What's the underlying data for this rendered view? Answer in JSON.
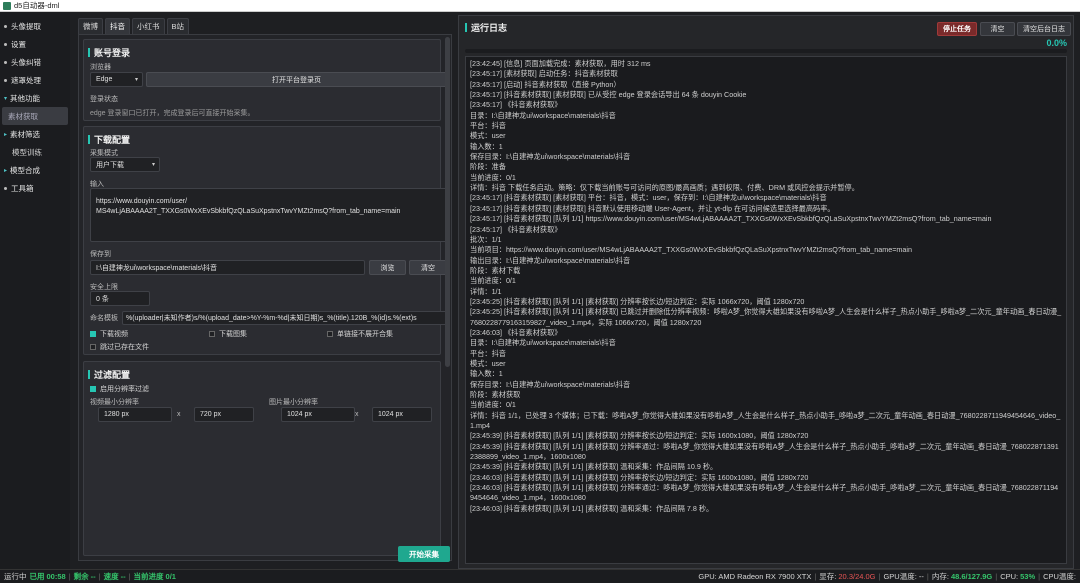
{
  "window": {
    "title": "d5自动器-dml"
  },
  "sidebar": {
    "items": [
      {
        "label": "头像提取",
        "type": "top"
      },
      {
        "label": "设置",
        "type": "top"
      },
      {
        "label": "头像纠错",
        "type": "top"
      },
      {
        "label": "遮罩处理",
        "type": "top"
      },
      {
        "label": "其他功能",
        "type": "group"
      },
      {
        "label": "素材获取",
        "type": "active"
      },
      {
        "label": "素材筛选",
        "type": "group"
      },
      {
        "label": "模型训练",
        "type": "sub"
      },
      {
        "label": "模型合成",
        "type": "group"
      },
      {
        "label": "工具箱",
        "type": "top"
      }
    ]
  },
  "tabs": [
    "微博",
    "抖音",
    "小红书",
    "B站"
  ],
  "account": {
    "title": "账号登录",
    "browser_label": "浏览器",
    "browser_value": "Edge",
    "open_login_button": "打开平台登录页",
    "login_status_label": "登录状态",
    "login_status_text": "edge 登录窗口已打开，完成登录后可直接开始采集。"
  },
  "download": {
    "title": "下载配置",
    "mode_label": "采集模式",
    "mode_value": "用户下载",
    "input_label": "输入",
    "input_value": "https://www.douyin.com/user/\nMS4wLjABAAAA2T_TXXGs0WxXEvSbkbfQzQLaSuXpstnxTwvYMZt2msQ?from_tab_name=main",
    "save_label": "保存到",
    "save_value": "I:\\自建神龙ui\\workspace\\materials\\抖音",
    "browse_button": "浏览",
    "clear_button": "清空",
    "limit_label": "安全上限",
    "limit_value": "0 条",
    "naming_label": "命名模板",
    "naming_value": "%(uploader|未知作者)s/%(upload_date>%Y-%m-%d|未知日期)s_%(title).120B_%(id)s.%(ext)s",
    "opt_video": "下载视频",
    "opt_images": "下载图集",
    "opt_single": "单链接不展开合集",
    "opt_skip": "跳过已存在文件"
  },
  "filter": {
    "title": "过滤配置",
    "enable_label": "启用分辨率过滤",
    "video_min_label": "视频最小分辨率",
    "video_w": "1280 px",
    "video_h": "720 px",
    "image_min_label": "图片最小分辨率",
    "image_w": "1024 px",
    "image_h": "1024 px",
    "x": "x"
  },
  "start_button": "开始采集",
  "log_panel": {
    "title": "运行日志",
    "stop_button": "停止任务",
    "clear_button": "清空",
    "clear_bg_button": "清空后台日志",
    "progress_text": "0.0%",
    "progress_fraction": 0.0,
    "lines": [
      "[23:42:45] [信息] 页面加载完成：素材获取，用时 312 ms",
      "[23:45:17] [素材获取] 启动任务：抖音素材获取",
      "[23:45:17] [启动] 抖音素材获取（直接 Python）",
      "[23:45:17] [抖音素材获取] [素材获取] 已从受控 edge 登录会话导出 64 条 douyin Cookie",
      "[23:45:17] 《抖音素材获取》",
      "目录：I:\\自建神龙ui\\workspace\\materials\\抖音",
      "平台：抖音",
      "模式：user",
      "输入数：1",
      "保存目录：I:\\自建神龙ui\\workspace\\materials\\抖音",
      "阶段：准备",
      "当前进度：0/1",
      "详情：抖音 下载任务启动。策略：仅下载当前账号可访问的原图/最高画质；遇到权限、付费、DRM 或风控会提示并暂停。",
      "[23:45:17] [抖音素材获取] [素材获取] 平台：抖音，模式：user，保存到：I:\\自建神龙ui\\workspace\\materials\\抖音",
      "[23:45:17] [抖音素材获取] [素材获取] 抖音默认使用移动端 User-Agent，并让 yt-dlp 在可访问候选里选择最高码率。",
      "[23:45:17] [抖音素材获取] [队列 1/1] https://www.douyin.com/user/MS4wLjABAAAA2T_TXXGs0WxXEvSbkbfQzQLaSuXpstnxTwvYMZt2msQ?from_tab_name=main",
      "[23:45:17] 《抖音素材获取》",
      "批次：1/1",
      "当前项目：https://www.douyin.com/user/MS4wLjABAAAA2T_TXXGs0WxXEvSbkbfQzQLaSuXpstnxTwvYMZt2msQ?from_tab_name=main",
      "输出目录：I:\\自建神龙ui\\workspace\\materials\\抖音",
      "阶段：素材下载",
      "当前进度：0/1",
      "详情：1/1",
      "[23:45:25] [抖音素材获取] [队列 1/1] [素材获取] 分辨率按长边/短边判定：实际 1066x720，阈值 1280x720",
      "[23:45:25] [抖音素材获取] [队列 1/1] [素材获取] 已跳过并删除低分辨率视频：哆啦A梦_你觉得大雄如果没有哆啦A梦_人生会是什么样子_热点小助手_哆啦a梦_二次元_童年动画_春日动漫_7680228779163159827_video_1.mp4，实际 1066x720，阈值 1280x720",
      "[23:46:03] 《抖音素材获取》",
      "目录：I:\\自建神龙ui\\workspace\\materials\\抖音",
      "平台：抖音",
      "模式：user",
      "输入数：1",
      "保存目录：I:\\自建神龙ui\\workspace\\materials\\抖音",
      "阶段：素材获取",
      "当前进度：0/1",
      "详情：抖音 1/1，已处理 3 个媒体；已下载：哆啦A梦_你觉得大雄如果没有哆啦A梦_人生会是什么样子_热点小助手_哆啦a梦_二次元_童年动画_春日动漫_7680228711949454646_video_1.mp4",
      "[23:45:39] [抖音素材获取] [队列 1/1] [素材获取] 分辨率按长边/短边判定：实际 1600x1080，阈值 1280x720",
      "[23:45:39] [抖音素材获取] [队列 1/1] [素材获取] 分辨率通过：哆啦A梦_你觉得大雄如果没有哆啦A梦_人生会是什么样子_热点小助手_哆啦a梦_二次元_童年动画_春日动漫_7680228713912388899_video_1.mp4，1600x1080",
      "[23:45:39] [抖音素材获取] [队列 1/1] [素材获取] 温和采集：作品间隔 10.9 秒。",
      "[23:46:03] [抖音素材获取] [队列 1/1] [素材获取] 分辨率按长边/短边判定：实际 1600x1080，阈值 1280x720",
      "[23:46:03] [抖音素材获取] [队列 1/1] [素材获取] 分辨率通过：哆啦A梦_你觉得大雄如果没有哆啦A梦_人生会是什么样子_热点小助手_哆啦a梦_二次元_童年动画_春日动漫_7680228711949454646_video_1.mp4，1600x1080",
      "[23:46:03] [抖音素材获取] [队列 1/1] [素材获取] 温和采集：作品间隔 7.8 秒。"
    ]
  },
  "statusbar": {
    "running": "运行中",
    "elapsed_label": "已用",
    "elapsed": "00:58",
    "remaining_label": "剩余",
    "remaining": "--",
    "speed_label": "速度",
    "speed": "--",
    "progress_label": "当前进度",
    "progress": "0/1",
    "gpu": "GPU: AMD Radeon RX 7900 XTX",
    "vram_label": "显存:",
    "vram": "20.3/24.0G",
    "gpu_temp": "GPU温度: --",
    "mem_label": "内存:",
    "mem": "48.6/127.9G",
    "cpu_label": "CPU:",
    "cpu": "53%",
    "cpu_temp": "CPU温度:"
  },
  "colors": {
    "accent": "#26c6b3",
    "stop": "#7a2a2a",
    "ok": "#35c46b",
    "warn": "#e85555"
  }
}
